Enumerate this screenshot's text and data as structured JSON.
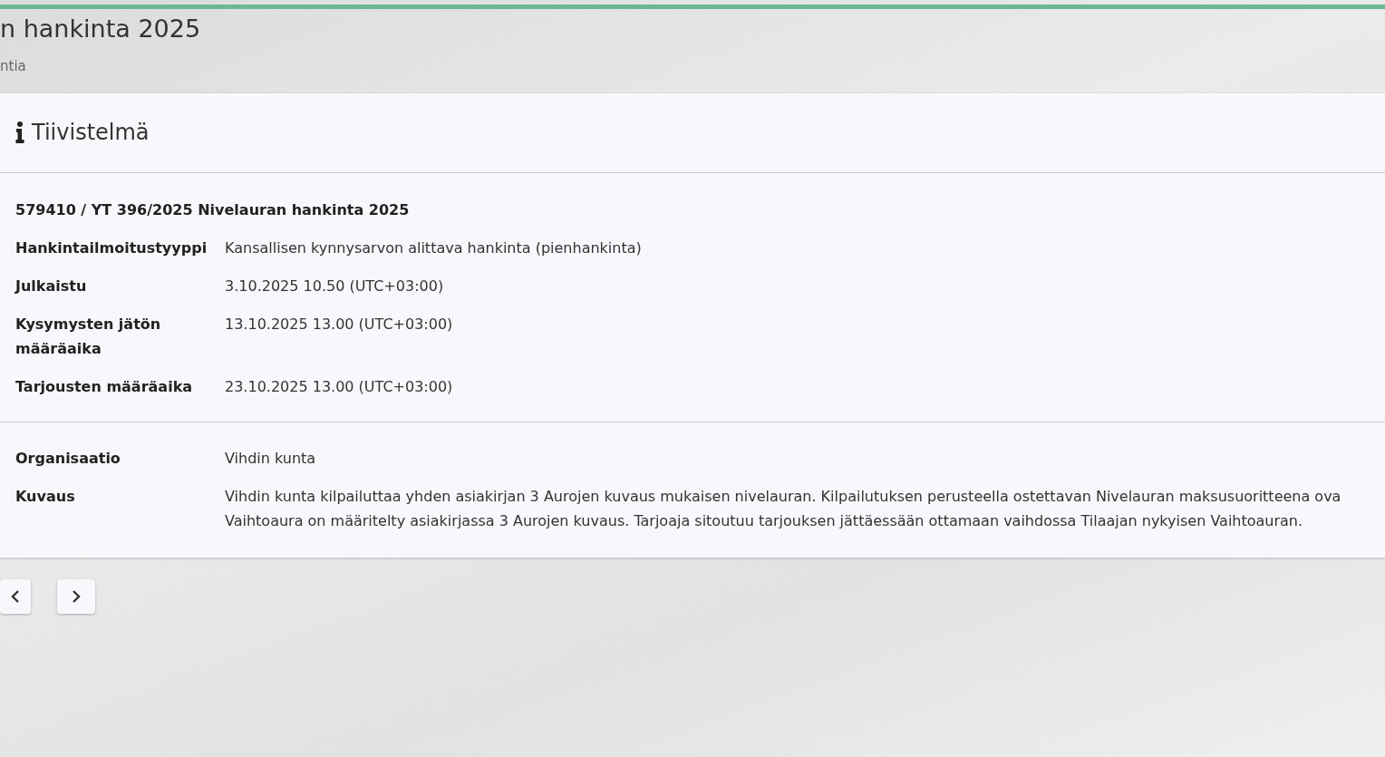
{
  "page": {
    "title": "n hankinta 2025",
    "subtitle": "ntia"
  },
  "panel": {
    "heading": "Tiivistelmä",
    "summary_title": "579410 / YT 396/2025 Nivelauran hankinta 2025",
    "fields": [
      {
        "label": "Hankintailmoitustyyppi",
        "value": "Kansallisen kynnysarvon alittava hankinta (pienhankinta)"
      },
      {
        "label": "Julkaistu",
        "value": "3.10.2025 10.50 (UTC+03:00)"
      },
      {
        "label": "Kysymysten jätön määräaika",
        "value": "13.10.2025 13.00 (UTC+03:00)"
      },
      {
        "label": "Tarjousten määräaika",
        "value": "23.10.2025 13.00 (UTC+03:00)"
      }
    ],
    "details": [
      {
        "label": "Organisaatio",
        "lines": [
          "Vihdin kunta"
        ]
      },
      {
        "label": "Kuvaus",
        "lines": [
          "Vihdin kunta kilpailuttaa yhden asiakirjan 3 Aurojen kuvaus mukaisen nivelauran. Kilpailutuksen perusteella ostettavan Nivelauran maksusuoritteena ova",
          "Vaihtoaura on määritelty asiakirjassa 3 Aurojen kuvaus. Tarjoaja sitoutuu tarjouksen jättäessään ottamaan vaihdossa Tilaajan nykyisen Vaihtoauran."
        ]
      }
    ]
  },
  "pager": [
    {
      "kind": "previous"
    },
    {
      "kind": "next"
    }
  ]
}
